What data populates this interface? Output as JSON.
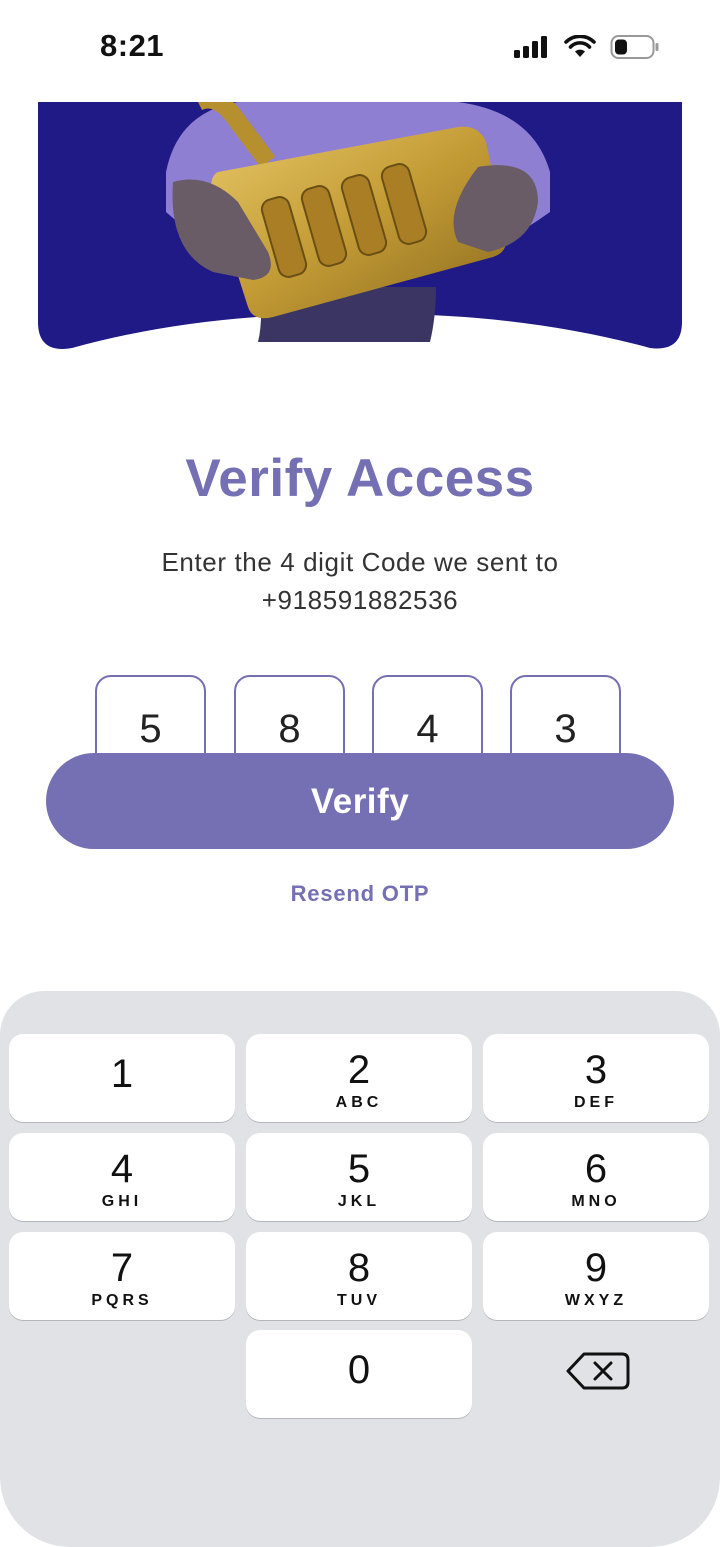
{
  "status_bar": {
    "time": "8:21"
  },
  "title": "Verify Access",
  "subtitle_line1": "Enter the 4 digit Code we sent to",
  "subtitle_line2": "+918591882536",
  "otp_digits": [
    "5",
    "8",
    "4",
    "3"
  ],
  "verify_label": "Verify",
  "resend_label": "Resend OTP",
  "accent_color": "#7570b3",
  "hero_background_color": "#1f1a85",
  "keypad": {
    "keys": [
      {
        "num": "1",
        "letters": ""
      },
      {
        "num": "2",
        "letters": "ABC"
      },
      {
        "num": "3",
        "letters": "DEF"
      },
      {
        "num": "4",
        "letters": "GHI"
      },
      {
        "num": "5",
        "letters": "JKL"
      },
      {
        "num": "6",
        "letters": "MNO"
      },
      {
        "num": "7",
        "letters": "PQRS"
      },
      {
        "num": "8",
        "letters": "TUV"
      },
      {
        "num": "9",
        "letters": "WXYZ"
      },
      {
        "num": "0",
        "letters": ""
      }
    ],
    "delete_icon": "backspace-icon"
  }
}
